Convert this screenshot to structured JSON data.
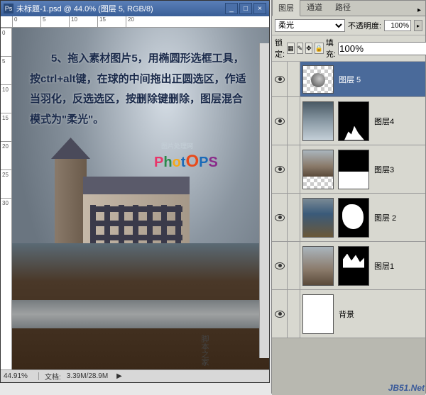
{
  "doc": {
    "title": "未标题-1.psd @ 44.0% (图层 5, RGB/8)",
    "zoom": "44.91%",
    "docsize_label": "文档:",
    "docsize": "3.39M/28.9M"
  },
  "tutorial": {
    "text": "　　5、拖入素材图片5，用椭圆形选框工具，按ctrl+alt键，在球的中间拖出正圆选区，作适当羽化，反选选区，按删除键删除，图层混合模式为\"柔光\"。",
    "logo_sub": "图片处理网",
    "logo": {
      "p1": "P",
      "h": "h",
      "o1": "o",
      "t": "t",
      "o2": "O",
      "p2": "P",
      "s": "S"
    }
  },
  "panel": {
    "tabs": {
      "layers": "图层",
      "channels": "通道",
      "paths": "路径"
    },
    "blend_mode": "柔光",
    "opacity_label": "不透明度:",
    "opacity": "100%",
    "lock_label": "锁定:",
    "fill_label": "填充:",
    "fill": "100%"
  },
  "layers": [
    {
      "name": "图层 5",
      "selected": true,
      "mask": "none",
      "thumb": "globe"
    },
    {
      "name": "图层4",
      "mask": "castle-sil",
      "thumb": "clouds"
    },
    {
      "name": "图层3",
      "mask": "horizon",
      "thumb": "castle"
    },
    {
      "name": "图层 2",
      "mask": "blob",
      "thumb": "beach"
    },
    {
      "name": "图层1",
      "mask": "cow",
      "thumb": "castle"
    },
    {
      "name": "背景",
      "mask": "none",
      "thumb": "white",
      "locked": true
    }
  ],
  "ruler_h": [
    "0",
    "5",
    "10",
    "15",
    "20"
  ],
  "ruler_v": [
    "0",
    "5",
    "10",
    "15",
    "20",
    "25",
    "30"
  ],
  "watermark": "JB51.Net",
  "watermark2": "脚本之家"
}
